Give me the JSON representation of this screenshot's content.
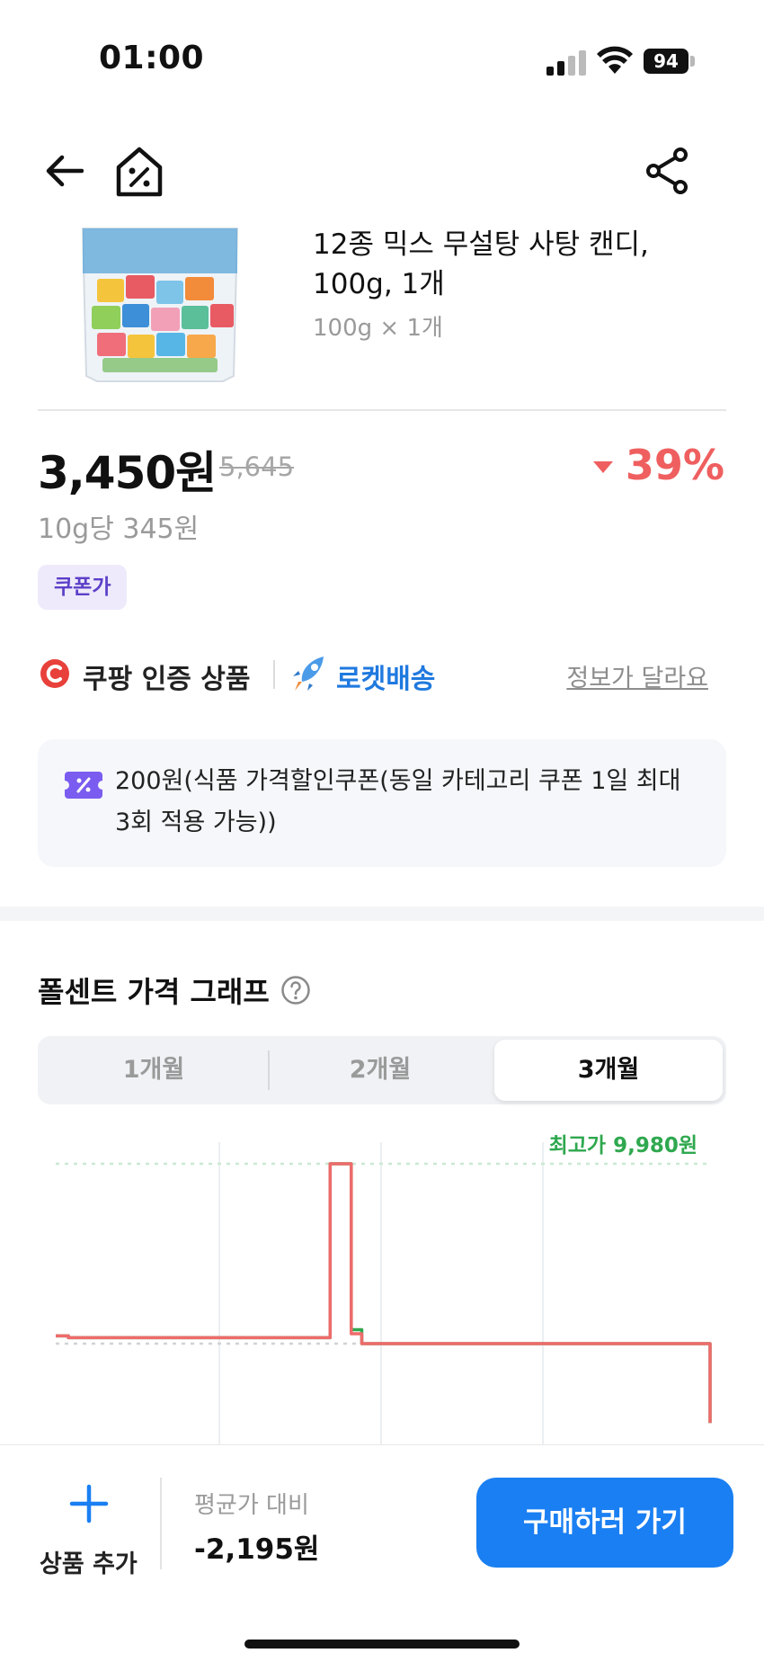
{
  "status": {
    "time": "01:00",
    "battery": "94"
  },
  "product": {
    "title": "12종 믹스 무설탕 사탕 캔디, 100g, 1개",
    "subtitle": "100g × 1개"
  },
  "price": {
    "current": "3,450원",
    "original": "5,645",
    "discount": "39%",
    "unit_price": "10g당 345원",
    "coupon_chip": "쿠폰가"
  },
  "badges": {
    "certified": "쿠팡 인증 상품",
    "rocket": "로켓배송",
    "wrong_info": "정보가 달라요"
  },
  "coupon": {
    "text": "200원(식품 가격할인쿠폰(동일 카테고리 쿠폰 1일 최대 3회 적용 가능))"
  },
  "graph": {
    "title": "폴센트 가격 그래프",
    "tabs": [
      "1개월",
      "2개월",
      "3개월"
    ],
    "selected_tab": "3개월",
    "max_label": "최고가 9,980원"
  },
  "chart_data": {
    "type": "line",
    "x": [
      0,
      8,
      12,
      20,
      30,
      40,
      50,
      60,
      70,
      80,
      90,
      100,
      110,
      120,
      130,
      140,
      150,
      160,
      170,
      180,
      190,
      200,
      210,
      220,
      230,
      240,
      250,
      260,
      270,
      280,
      290,
      300,
      310,
      320,
      330,
      340,
      350,
      360,
      370,
      380,
      390,
      400,
      410,
      420,
      430,
      440,
      450,
      460,
      470,
      480,
      490,
      500,
      510,
      520,
      530,
      540,
      550,
      560,
      570,
      580,
      590,
      600,
      610,
      620
    ],
    "series": [
      {
        "color": "#2fa84f",
        "values": [
          5645,
          5645,
          5600,
          5600,
          5600,
          5600,
          5600,
          5600,
          5600,
          5600,
          5600,
          5600,
          5600,
          5600,
          5600,
          5600,
          5600,
          5600,
          5600,
          5600,
          5600,
          5600,
          5600,
          5600,
          5600,
          5600,
          5600,
          9980,
          9980,
          5800,
          5450,
          5450,
          5450,
          5450,
          5450,
          5450,
          5450,
          5450,
          5450,
          5450,
          5450,
          5450,
          5450,
          5450,
          5450,
          5450,
          5450,
          5450,
          5450,
          5450,
          5450,
          5450,
          5450,
          5450,
          5450,
          5450,
          5450,
          5450,
          5450,
          5450,
          5450,
          5450,
          5450,
          3450
        ]
      },
      {
        "color": "#ef6b6b",
        "values": [
          5645,
          5645,
          5600,
          5600,
          5600,
          5600,
          5600,
          5600,
          5600,
          5600,
          5600,
          5600,
          5600,
          5600,
          5600,
          5600,
          5600,
          5600,
          5600,
          5600,
          5600,
          5600,
          5600,
          5600,
          5600,
          5600,
          5600,
          9980,
          9980,
          5700,
          5450,
          5450,
          5450,
          5450,
          5450,
          5450,
          5450,
          5450,
          5450,
          5450,
          5450,
          5450,
          5450,
          5450,
          5450,
          5450,
          5450,
          5450,
          5450,
          5450,
          5450,
          5450,
          5450,
          5450,
          5450,
          5450,
          5450,
          5450,
          5450,
          5450,
          5450,
          5450,
          5450,
          3450
        ]
      }
    ],
    "max_value": 9980,
    "grid": true
  },
  "bottom": {
    "add_label": "상품 추가",
    "avg_label": "평균가 대비",
    "avg_value": "-2,195원",
    "buy_label": "구매하러 가기"
  }
}
